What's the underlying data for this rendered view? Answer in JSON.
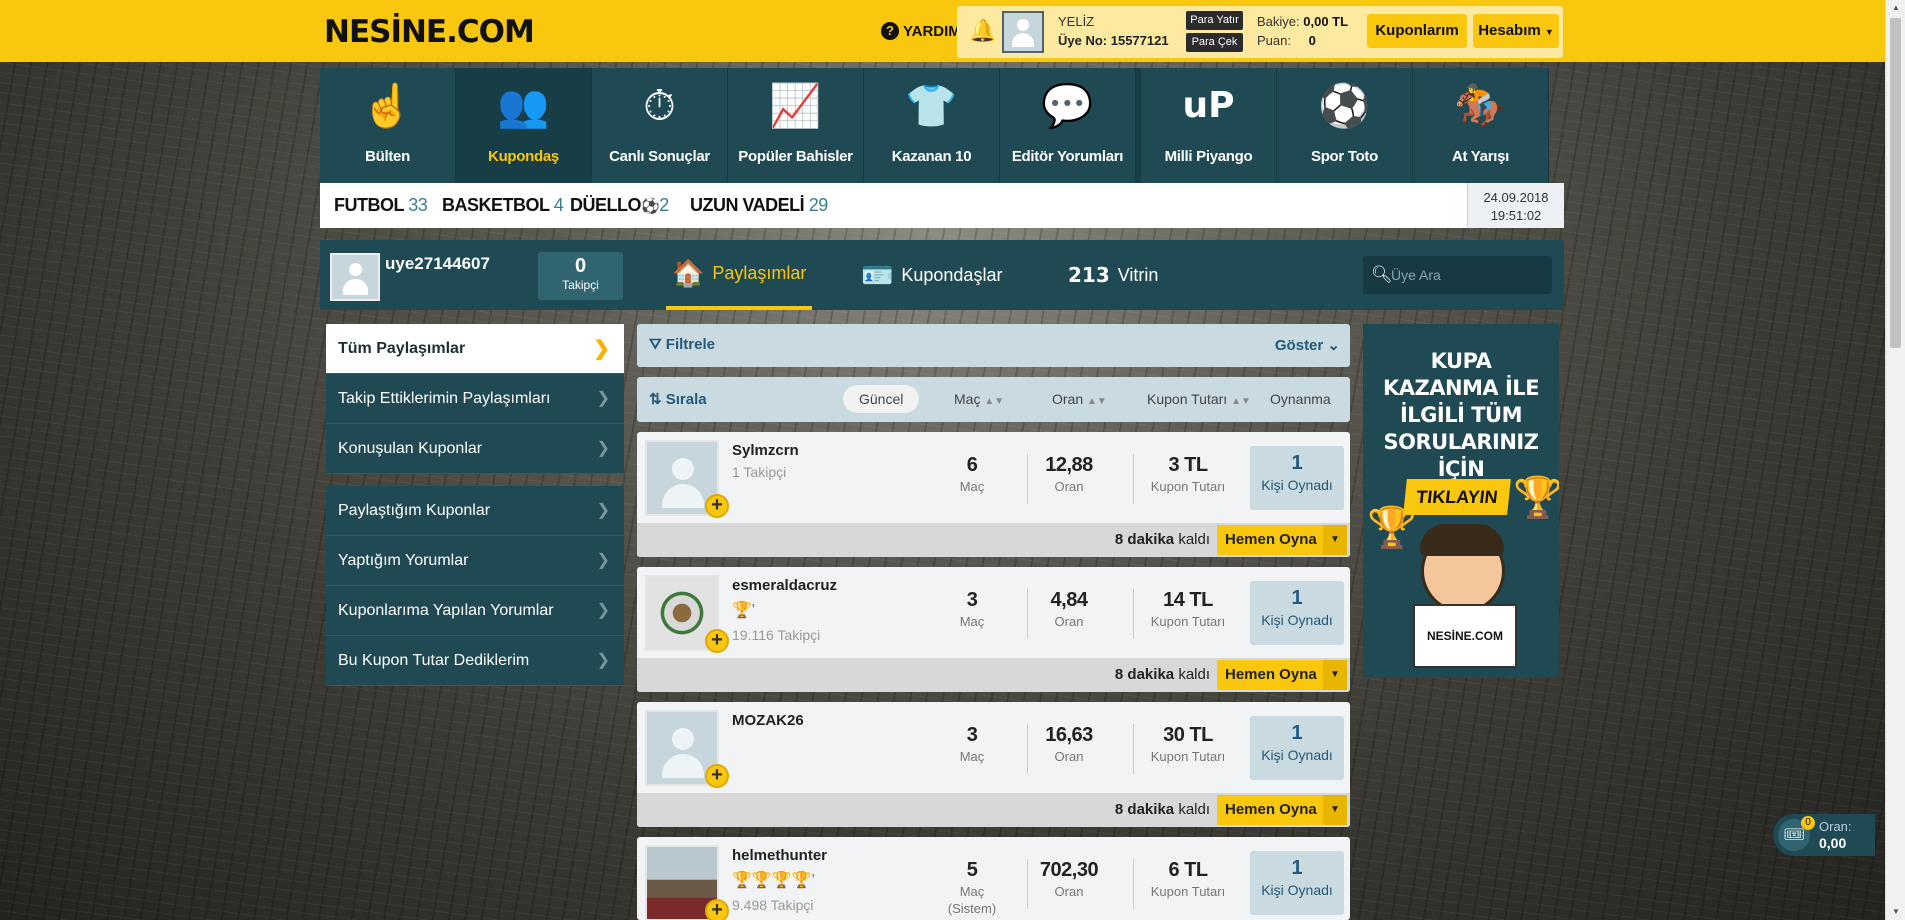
{
  "header": {
    "logo": "NESİNE.COM",
    "help_label": "YARDIM",
    "user_name": "YELİZ",
    "user_no": "Üye No: 15577121",
    "deposit_label": "Para Yatır",
    "withdraw_label": "Para Çek",
    "balance_label": "Bakiye:",
    "balance_value": "0,00 TL",
    "points_label": "Puan:",
    "points_value": "0",
    "coupons_button": "Kuponlarım",
    "account_button": "Hesabım"
  },
  "nav": [
    {
      "label": "Bülten",
      "icon": "hand-icon"
    },
    {
      "label": "Kupondaş",
      "icon": "users-icon"
    },
    {
      "label": "Canlı Sonuçlar",
      "icon": "stopwatch-icon"
    },
    {
      "label": "Popüler Bahisler",
      "icon": "bar-chart-icon"
    },
    {
      "label": "Kazanan 10",
      "icon": "jersey-icon"
    },
    {
      "label": "Editör Yorumları",
      "icon": "chat-icon"
    },
    {
      "label": "Milli Piyango",
      "icon": "mp-logo-icon"
    },
    {
      "label": "Spor Toto",
      "icon": "football-icon"
    },
    {
      "label": "At Yarışı",
      "icon": "horse-race-icon"
    }
  ],
  "sports": [
    {
      "name": "FUTBOL",
      "count": "33"
    },
    {
      "name": "BASKETBOL",
      "count": "4"
    },
    {
      "name": "DÜELLO",
      "count": "2"
    },
    {
      "name": "UZUN VADELİ",
      "count": "29"
    }
  ],
  "datetime": {
    "date": "24.09.2018",
    "time": "19:51:02"
  },
  "profile": {
    "username": "uye27144607",
    "followers_value": "0",
    "followers_label": "Takipçi",
    "tabs": [
      "Paylaşımlar",
      "Kupondaşlar",
      "Vitrin"
    ],
    "search_placeholder": "Üye Ara"
  },
  "sidebar": {
    "group1": [
      "Tüm Paylaşımlar",
      "Takip Ettiklerimin Paylaşımları",
      "Konuşulan Kuponlar"
    ],
    "group2": [
      "Paylaştığım Kuponlar",
      "Yaptığım Yorumlar",
      "Kuponlarıma Yapılan Yorumlar",
      "Bu Kupon Tutar Dediklerim"
    ]
  },
  "filter": {
    "label": "Filtrele",
    "show_label": "Göster"
  },
  "sort": {
    "label": "Sırala",
    "options": [
      "Güncel",
      "Maç",
      "Oran",
      "Kupon Tutarı",
      "Oynanma"
    ]
  },
  "coupons": [
    {
      "user": "Sylmzcrn",
      "followers": "1 Takipçi",
      "trophies": "",
      "matches": "6",
      "matches_label": "Maç",
      "odds": "12,88",
      "odds_label": "Oran",
      "amount": "3 TL",
      "amount_label": "Kupon Tutarı",
      "played": "1",
      "played_label": "Kişi Oynadı",
      "time_value": "8 dakika",
      "time_suffix": "kaldı",
      "play_label": "Hemen Oyna"
    },
    {
      "user": "esmeraldacruz",
      "followers": "19.116 Takipçi",
      "trophies": "🏆'",
      "matches": "3",
      "matches_label": "Maç",
      "odds": "4,84",
      "odds_label": "Oran",
      "amount": "14 TL",
      "amount_label": "Kupon Tutarı",
      "played": "1",
      "played_label": "Kişi Oynadı",
      "time_value": "8 dakika",
      "time_suffix": "kaldı",
      "play_label": "Hemen Oyna"
    },
    {
      "user": "MOZAK26",
      "followers": "",
      "trophies": "",
      "matches": "3",
      "matches_label": "Maç",
      "odds": "16,63",
      "odds_label": "Oran",
      "amount": "30 TL",
      "amount_label": "Kupon Tutarı",
      "played": "1",
      "played_label": "Kişi Oynadı",
      "time_value": "8 dakika",
      "time_suffix": "kaldı",
      "play_label": "Hemen Oyna"
    },
    {
      "user": "helmethunter",
      "followers": "9.498 Takipçi",
      "trophies": "🏆🏆🏆🏆'",
      "matches": "5",
      "matches_label": "Maç",
      "matches_sub": "(Sistem)",
      "odds": "702,30",
      "odds_label": "Oran",
      "amount": "6 TL",
      "amount_label": "Kupon Tutarı",
      "played": "1",
      "played_label": "Kişi Oynadı"
    }
  ],
  "ad": {
    "headline": "KUPA KAZANMA İLE İLGİLİ TÜM SORULARINIZ İÇİN",
    "cta": "TIKLAYIN",
    "brand": "NESİNE.COM"
  },
  "betslip": {
    "count": "0",
    "odds_label": "Oran:",
    "odds_value": "0,00"
  }
}
